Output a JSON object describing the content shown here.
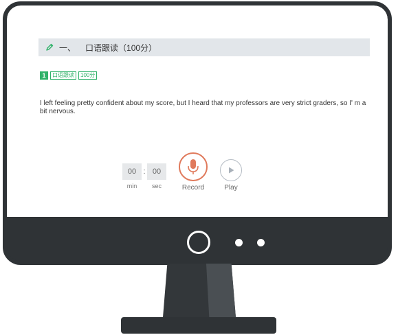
{
  "section": {
    "number": "一、",
    "title": "口语跟读（100分）"
  },
  "question": {
    "index": "1",
    "tags": [
      "口语跟读",
      "100分"
    ],
    "text": "I left feeling pretty confident about my score, but I heard that my professors are very strict graders, so I'  m a bit nervous."
  },
  "timer": {
    "minutes": "00",
    "seconds": "00",
    "separator": ":",
    "min_label": "min",
    "sec_label": "sec"
  },
  "controls": {
    "record_label": "Record",
    "play_label": "Play"
  },
  "colors": {
    "accent_green": "#31b26a",
    "record_orange": "#e07a5c",
    "bezel": "#2f3336"
  },
  "icons": [
    "pencil-icon",
    "microphone-icon",
    "play-icon"
  ]
}
